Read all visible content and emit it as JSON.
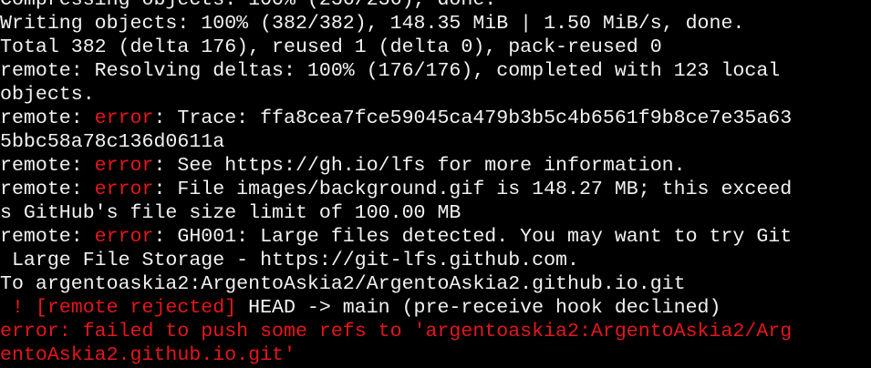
{
  "colors": {
    "background": "#000000",
    "text": "#f2f2f2",
    "error": "#e5161b"
  },
  "lines": [
    [
      {
        "t": "Compressing objects: 100% (236/236), done.",
        "c": "white"
      }
    ],
    [
      {
        "t": "Writing objects: 100% (382/382), 148.35 MiB | 1.50 MiB/s, done.",
        "c": "white"
      }
    ],
    [
      {
        "t": "Total 382 (delta 176), reused 1 (delta 0), pack-reused 0",
        "c": "white"
      }
    ],
    [
      {
        "t": "remote: Resolving deltas: 100% (176/176), completed with 123 local",
        "c": "white"
      }
    ],
    [
      {
        "t": "objects.",
        "c": "white"
      }
    ],
    [
      {
        "t": "remote: ",
        "c": "white"
      },
      {
        "t": "error",
        "c": "err"
      },
      {
        "t": ": Trace: ffa8cea7fce59045ca479b3b5c4b6561f9b8ce7e35a63",
        "c": "white"
      }
    ],
    [
      {
        "t": "5bbc58a78c136d0611a",
        "c": "white"
      }
    ],
    [
      {
        "t": "remote: ",
        "c": "white"
      },
      {
        "t": "error",
        "c": "err"
      },
      {
        "t": ": See https://gh.io/lfs for more information.",
        "c": "white"
      }
    ],
    [
      {
        "t": "remote: ",
        "c": "white"
      },
      {
        "t": "error",
        "c": "err"
      },
      {
        "t": ": File images/background.gif is 148.27 MB; this exceed",
        "c": "white"
      }
    ],
    [
      {
        "t": "s GitHub's file size limit of 100.00 MB",
        "c": "white"
      }
    ],
    [
      {
        "t": "remote: ",
        "c": "white"
      },
      {
        "t": "error",
        "c": "err"
      },
      {
        "t": ": GH001: Large files detected. You may want to try Git",
        "c": "white"
      }
    ],
    [
      {
        "t": " Large File Storage - https://git-lfs.github.com.",
        "c": "white"
      }
    ],
    [
      {
        "t": "To argentoaskia2:ArgentoAskia2/ArgentoAskia2.github.io.git",
        "c": "white"
      }
    ],
    [
      {
        "t": " ! [remote rejected]",
        "c": "err"
      },
      {
        "t": " HEAD -> main (pre-receive hook declined)",
        "c": "white"
      }
    ],
    [
      {
        "t": "error: failed to push some refs to 'argentoaskia2:ArgentoAskia2/Arg",
        "c": "err"
      }
    ],
    [
      {
        "t": "entoAskia2.github.io.git'",
        "c": "err"
      }
    ]
  ]
}
